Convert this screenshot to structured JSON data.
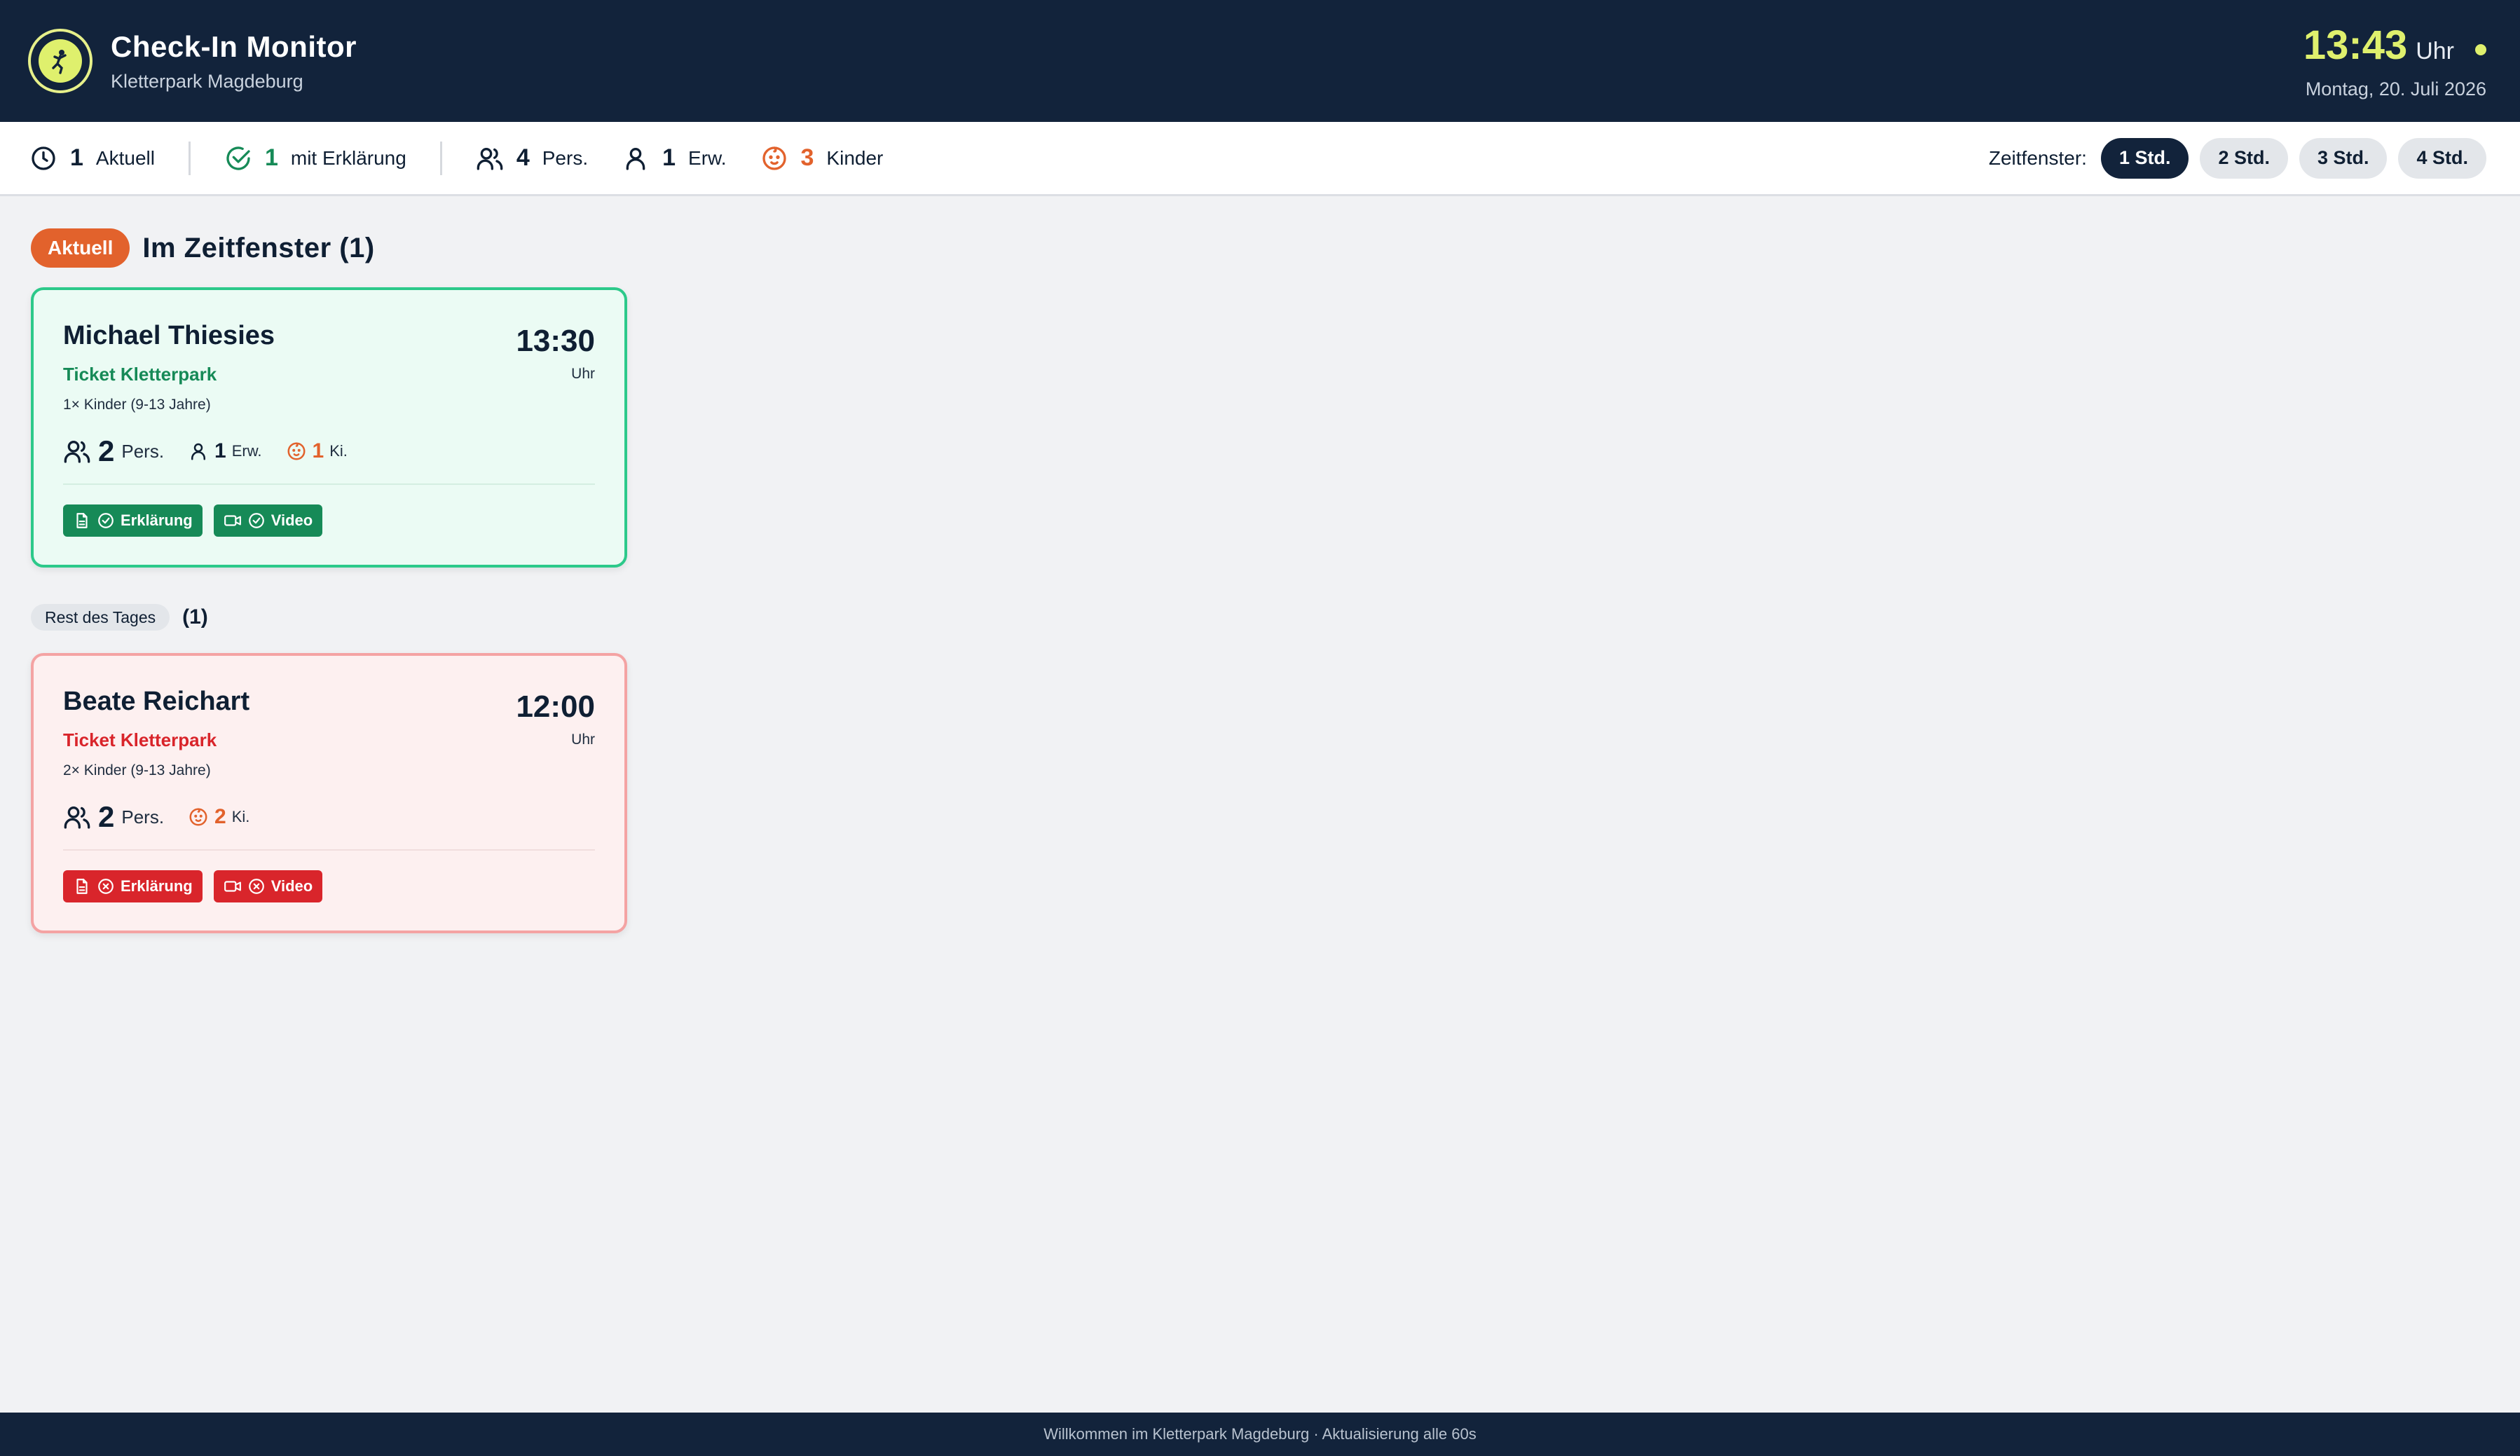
{
  "header": {
    "title": "Check-In Monitor",
    "subtitle": "Kletterpark Magdeburg",
    "logo_text": "KLETTERPARK MAGDEBURG",
    "clock_time": "13:43",
    "clock_unit": "Uhr",
    "date": "Montag, 20. Juli 2026"
  },
  "stats": {
    "aktuell_count": "1",
    "aktuell_label": "Aktuell",
    "erklaerung_count": "1",
    "erklaerung_label": "mit Erklärung",
    "personen_count": "4",
    "personen_label": "Pers.",
    "erwachsene_count": "1",
    "erwachsene_label": "Erw.",
    "kinder_count": "3",
    "kinder_label": "Kinder"
  },
  "zeitfenster": {
    "label": "Zeitfenster:",
    "options": [
      "1 Std.",
      "2 Std.",
      "3 Std.",
      "4 Std."
    ],
    "selected": "1 Std."
  },
  "section_current": {
    "badge": "Aktuell",
    "title": "Im Zeitfenster (1)"
  },
  "section_rest": {
    "badge": "Rest des Tages",
    "count": "(1)"
  },
  "cards": [
    {
      "name": "Michael Thiesies",
      "ticket": "Ticket Kletterpark",
      "detail": "1× Kinder (9-13 Jahre)",
      "time": "13:30",
      "time_unit": "Uhr",
      "persons": "2",
      "persons_label": "Pers.",
      "adults": "1",
      "adults_label": "Erw.",
      "kids": "1",
      "kids_label": "Ki.",
      "tag_erklaerung": "Erklärung",
      "tag_video": "Video",
      "status": "ok"
    },
    {
      "name": "Beate Reichart",
      "ticket": "Ticket Kletterpark",
      "detail": "2× Kinder (9-13 Jahre)",
      "time": "12:00",
      "time_unit": "Uhr",
      "persons": "2",
      "persons_label": "Pers.",
      "kids": "2",
      "kids_label": "Ki.",
      "tag_erklaerung": "Erklärung",
      "tag_video": "Video",
      "status": "missing"
    }
  ],
  "footer": {
    "text": "Willkommen im Kletterpark Magdeburg · Aktualisierung alle 60s"
  },
  "colors": {
    "navy": "#12233b",
    "lime": "#dff06d",
    "orange": "#e2622c",
    "green": "#168a57",
    "red": "#d9252b"
  }
}
